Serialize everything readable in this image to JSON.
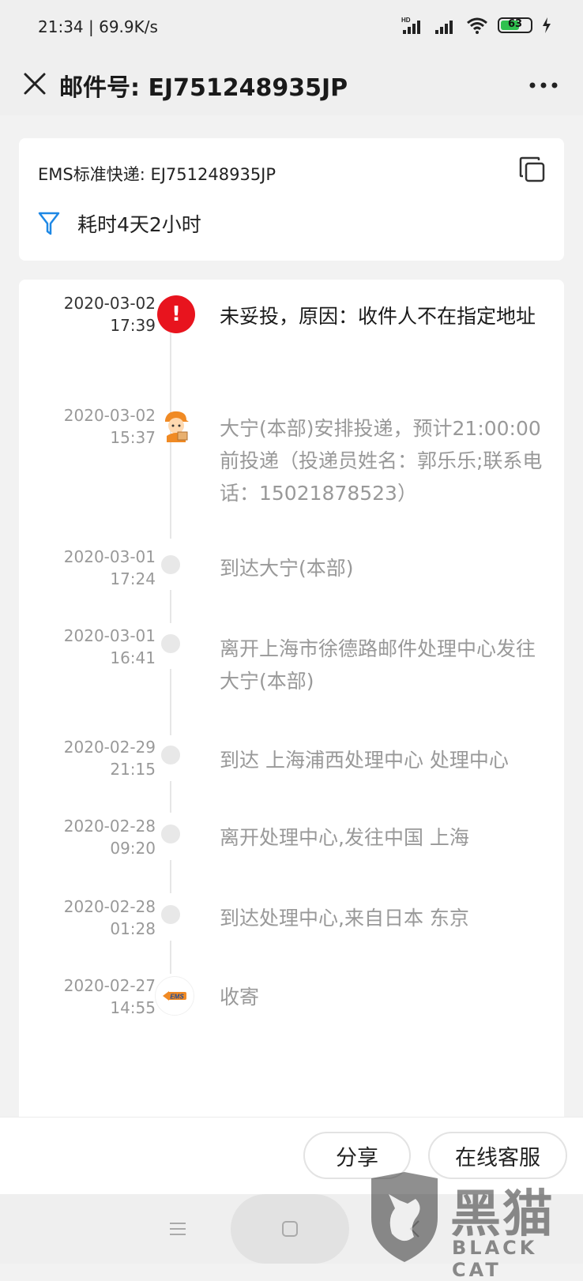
{
  "status_bar": {
    "time": "21:34",
    "speed": "69.9K/s",
    "network_label": "HD",
    "battery": "63",
    "battery_level": 0.63
  },
  "header": {
    "title": "邮件号: EJ751248935JP"
  },
  "info": {
    "courier_label": "EMS标准快递: EJ751248935JP",
    "duration": "耗时4天2小时"
  },
  "timeline": {
    "events": [
      {
        "date": "2020-03-02",
        "time": "17:39",
        "text": "未妥投，原因：收件人不在指定地址",
        "icon": "alert-icon"
      },
      {
        "date": "2020-03-02",
        "time": "15:37",
        "text": "大宁(本部)安排投递，预计21:00:00前投递（投递员姓名：郭乐乐;联系电话：15021878523）",
        "icon": "courier-icon"
      },
      {
        "date": "2020-03-01",
        "time": "17:24",
        "text": "到达大宁(本部)",
        "icon": "dot"
      },
      {
        "date": "2020-03-01",
        "time": "16:41",
        "text": "离开上海市徐德路邮件处理中心发往大宁(本部)",
        "icon": "dot"
      },
      {
        "date": "2020-02-29",
        "time": "21:15",
        "text": "到达 上海浦西处理中心 处理中心",
        "icon": "dot"
      },
      {
        "date": "2020-02-28",
        "time": "09:20",
        "text": "离开处理中心,发往中国 上海",
        "icon": "dot"
      },
      {
        "date": "2020-02-28",
        "time": "01:28",
        "text": "到达处理中心,来自日本 东京",
        "icon": "dot"
      },
      {
        "date": "2020-02-27",
        "time": "14:55",
        "text": "收寄",
        "icon": "ems-logo-icon"
      }
    ],
    "ems_logo_text": "EMS"
  },
  "actions": {
    "share": "分享",
    "customer_service": "在线客服"
  },
  "watermark": {
    "cn": "黑猫",
    "en": "BLACK CAT"
  },
  "colors": {
    "alert": "#e8141e",
    "filter_icon": "#1e88e5",
    "battery": "#2fc14f"
  }
}
